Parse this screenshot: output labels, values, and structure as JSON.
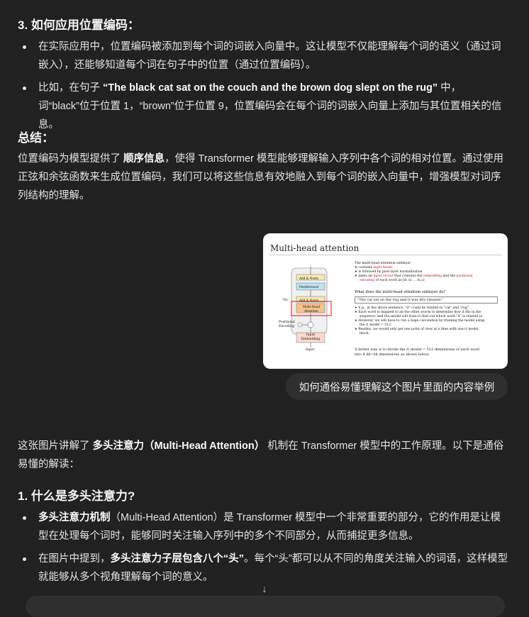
{
  "section3": {
    "heading": "3. 如何应用位置编码：",
    "b1": "在实际应用中，位置编码被添加到每个词的词嵌入向量中。这让模型不仅能理解每个词的语义（通过词嵌入），还能够知道每个词在句子中的位置（通过位置编码）。",
    "b2_pre": "比如，在句子 ",
    "b2_bold": "“The black cat sat on the couch and the brown dog slept on the rug”",
    "b2_post": " 中，词“black”位于位置 1，“brown”位于位置 9，位置编码会在每个词的词嵌入向量上添加与其位置相关的信息。"
  },
  "summary": {
    "heading": "总结：",
    "pre": "位置编码为模型提供了 ",
    "bold": "顺序信息",
    "post": "，使得 Transformer 模型能够理解输入序列中各个词的相对位置。通过使用正弦和余弦函数来生成位置编码，我们可以将这些信息有效地融入到每个词的嵌入向量中，增强模型对词序列结构的理解。"
  },
  "attachment": {
    "title": "Multi-head attention",
    "nx": "Nx",
    "blocks": {
      "add_norm": "Add & Norm",
      "feedforward": "Feedforward",
      "mha": "Multi-Head Attention",
      "pos_enc": "Positional Encoding",
      "input_emb": "Input Embedding",
      "input": "Input"
    },
    "lines": {
      "l1": "The multi-head attention sublayer",
      "l2a": "contains ",
      "l2b": "eight heads",
      "l3": "is followed by post-layer normalization",
      "l4a": "takes an ",
      "l4b": "input vector",
      "l4c": " that contains the ",
      "l4d": "embedding",
      "l4e": " and the ",
      "l4f": "positional",
      "l5a": "encoding",
      "l5b": " of each word as [d₁ d₂ … d₅₁₂]",
      "q": "What does the multi-head attention sublayer do?",
      "quote": "\"The cat sat on the rug and it was dry-cleaned.\"",
      "e1": "E.g., in the above sentence, \"it\" could be related to \"cat\" and \"rug\".",
      "e2": "Each word is mapped to all the other words to determine how it fits in the",
      "e3": "sequence, and the model will train to find out which word \"it\" is related to.",
      "e4": "However, we will have to run a huge calculation by training the model using",
      "e5": "the d_model = 512.",
      "e6": "Besides, we would only get one point of view at a time with one d_model",
      "e7": "block.",
      "f1": "A better way is to divide the d_model = 512 dimensions of each word",
      "f2": "into 8 dk=64 dimensions as shown below."
    }
  },
  "user_message": "如何通俗易懂理解这个图片里面的内容举例",
  "reply": {
    "intro_pre": "这张图片讲解了 ",
    "intro_bold": "多头注意力（Multi-Head Attention）",
    "intro_post": " 机制在 Transformer 模型中的工作原理。以下是通俗易懂的解读：",
    "heading1": "1. 什么是多头注意力?",
    "b1_bold": "多头注意力机制",
    "b1_post": "（Multi-Head Attention）是 Transformer 模型中一个非常重要的部分，它的作用是让模型在处理每个词时，能够同时关注输入序列中的多个不同部分，从而捕捉更多信息。",
    "b2_pre": "在图片中提到，",
    "b2_bold": "多头注意力子层包含八个“头”",
    "b2_post": "。每个“头”都可以从不同的角度关注输入的词语，这样模型就能够从多个视角理解每个词的意义。"
  },
  "scroll_icon": "↓"
}
